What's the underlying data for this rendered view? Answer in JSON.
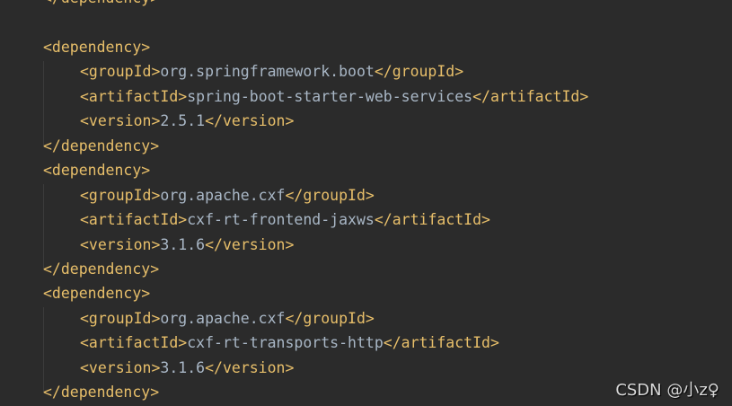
{
  "editor": {
    "colors": {
      "background": "#2b2b2b",
      "tag": "#e8bf6a",
      "text": "#a9b7c6"
    },
    "lines": [
      {
        "indent": 0,
        "open": "</dependency>",
        "value": "",
        "close": ""
      },
      {
        "indent": 0,
        "open": "",
        "value": "",
        "close": ""
      },
      {
        "indent": 0,
        "open": "<dependency>",
        "value": "",
        "close": ""
      },
      {
        "indent": 1,
        "open": "<groupId>",
        "value": "org.springframework.boot",
        "close": "</groupId>"
      },
      {
        "indent": 1,
        "open": "<artifactId>",
        "value": "spring-boot-starter-web-services",
        "close": "</artifactId>"
      },
      {
        "indent": 1,
        "open": "<version>",
        "value": "2.5.1",
        "close": "</version>"
      },
      {
        "indent": 0,
        "open": "</dependency>",
        "value": "",
        "close": ""
      },
      {
        "indent": 0,
        "open": "<dependency>",
        "value": "",
        "close": ""
      },
      {
        "indent": 1,
        "open": "<groupId>",
        "value": "org.apache.cxf",
        "close": "</groupId>"
      },
      {
        "indent": 1,
        "open": "<artifactId>",
        "value": "cxf-rt-frontend-jaxws",
        "close": "</artifactId>"
      },
      {
        "indent": 1,
        "open": "<version>",
        "value": "3.1.6",
        "close": "</version>"
      },
      {
        "indent": 0,
        "open": "</dependency>",
        "value": "",
        "close": ""
      },
      {
        "indent": 0,
        "open": "<dependency>",
        "value": "",
        "close": ""
      },
      {
        "indent": 1,
        "open": "<groupId>",
        "value": "org.apache.cxf",
        "close": "</groupId>"
      },
      {
        "indent": 1,
        "open": "<artifactId>",
        "value": "cxf-rt-transports-http",
        "close": "</artifactId>"
      },
      {
        "indent": 1,
        "open": "<version>",
        "value": "3.1.6",
        "close": "</version>"
      },
      {
        "indent": 0,
        "open": "</dependency>",
        "value": "",
        "close": ""
      }
    ]
  },
  "watermark": "CSDN @小z♀"
}
